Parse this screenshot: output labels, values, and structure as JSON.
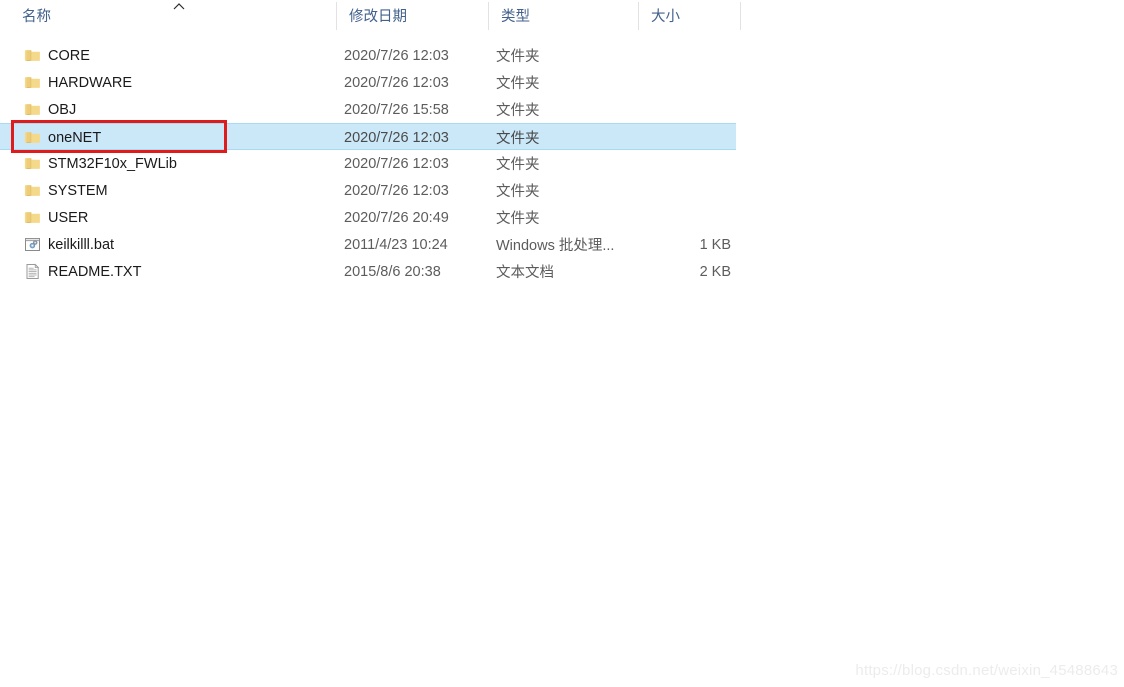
{
  "header": {
    "columns": [
      {
        "label": "名称",
        "key": "name"
      },
      {
        "label": "修改日期",
        "key": "date"
      },
      {
        "label": "类型",
        "key": "type"
      },
      {
        "label": "大小",
        "key": "size"
      }
    ],
    "sort_column": "名称",
    "sort_direction": "ascending",
    "sort_icon": "caret-up-icon"
  },
  "files": [
    {
      "name": "CORE",
      "date": "2020/7/26 12:03",
      "type": "文件夹",
      "size": "",
      "icon": "folder-icon",
      "selected": false
    },
    {
      "name": "HARDWARE",
      "date": "2020/7/26 12:03",
      "type": "文件夹",
      "size": "",
      "icon": "folder-icon",
      "selected": false
    },
    {
      "name": "OBJ",
      "date": "2020/7/26 15:58",
      "type": "文件夹",
      "size": "",
      "icon": "folder-icon",
      "selected": false
    },
    {
      "name": "oneNET",
      "date": "2020/7/26 12:03",
      "type": "文件夹",
      "size": "",
      "icon": "folder-icon",
      "selected": true
    },
    {
      "name": "STM32F10x_FWLib",
      "date": "2020/7/26 12:03",
      "type": "文件夹",
      "size": "",
      "icon": "folder-icon",
      "selected": false
    },
    {
      "name": "SYSTEM",
      "date": "2020/7/26 12:03",
      "type": "文件夹",
      "size": "",
      "icon": "folder-icon",
      "selected": false
    },
    {
      "name": "USER",
      "date": "2020/7/26 20:49",
      "type": "文件夹",
      "size": "",
      "icon": "folder-icon",
      "selected": false
    },
    {
      "name": "keilkilll.bat",
      "date": "2011/4/23 10:24",
      "type": "Windows 批处理...",
      "size": "1 KB",
      "icon": "batch-file-icon",
      "selected": false
    },
    {
      "name": "README.TXT",
      "date": "2015/8/6 20:38",
      "type": "文本文档",
      "size": "2 KB",
      "icon": "text-file-icon",
      "selected": false
    }
  ],
  "annotation": {
    "type": "red-rectangle",
    "target": "oneNET",
    "color": "#e01b1b"
  },
  "watermark": {
    "text": "https://blog.csdn.net/weixin_45488643"
  },
  "colors": {
    "selection_fill": "#cbe8f9",
    "selection_border": "#a8daf4",
    "header_text": "#43618d",
    "folder_icon": "#f7d884",
    "annotation": "#e01b1b"
  }
}
